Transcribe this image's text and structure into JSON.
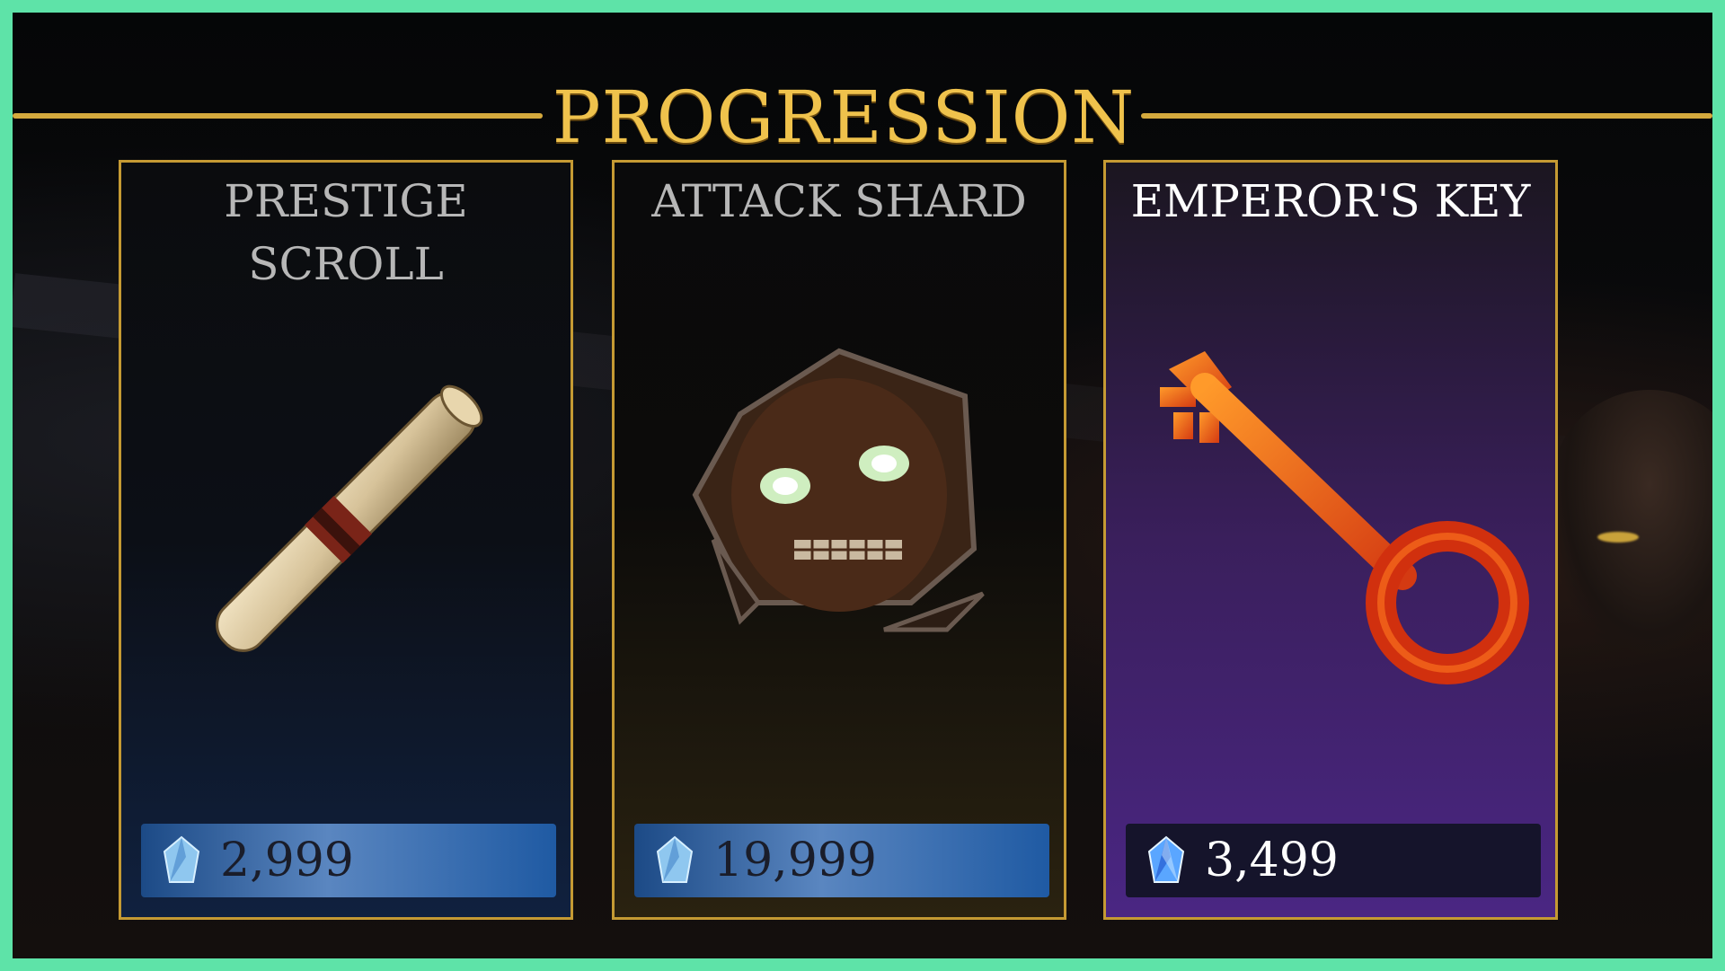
{
  "title": "PROGRESSION",
  "cards": [
    {
      "name": "PRESTIGE SCROLL",
      "price": "2,999",
      "item_icon": "scroll-icon",
      "currency_icon": "gem-icon"
    },
    {
      "name": "ATTACK SHARD",
      "price": "19,999",
      "item_icon": "titan-shard-icon",
      "currency_icon": "gem-icon"
    },
    {
      "name": "EMPEROR'S KEY",
      "price": "3,499",
      "item_icon": "key-icon",
      "currency_icon": "gem-icon"
    }
  ],
  "colors": {
    "frame": "#5ee3a8",
    "gold": "#d4a93d",
    "title": "#efc24c",
    "card1_bottom": "#10213f",
    "card2_bottom": "#2a2210",
    "card3_bottom": "#4a2683"
  }
}
